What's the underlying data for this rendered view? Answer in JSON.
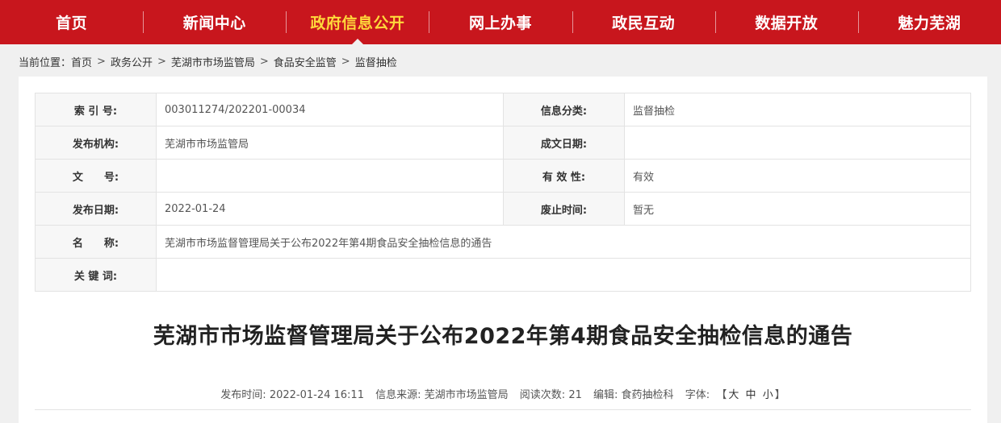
{
  "nav": {
    "items": [
      {
        "label": "首页"
      },
      {
        "label": "新闻中心"
      },
      {
        "label": "政府信息公开"
      },
      {
        "label": "网上办事"
      },
      {
        "label": "政民互动"
      },
      {
        "label": "数据开放"
      },
      {
        "label": "魅力芜湖"
      }
    ],
    "active_index": 2,
    "active_color": "#ffd93b",
    "bg_color": "#c8161d"
  },
  "breadcrumb": {
    "prefix": "当前位置：",
    "items": [
      "首页",
      "政务公开",
      "芜湖市市场监管局",
      "食品安全监管",
      "监督抽检"
    ],
    "separator": ">"
  },
  "info": {
    "index_no_label": "索 引 号:",
    "index_no": "003011274/202201-00034",
    "category_label": "信息分类:",
    "category": "监督抽检",
    "publisher_label": "发布机构:",
    "publisher": "芜湖市市场监管局",
    "created_label": "成文日期:",
    "created": "",
    "doc_no_label": "文　　号:",
    "doc_no": "",
    "validity_label": "有 效 性:",
    "validity": "有效",
    "pub_date_label": "发布日期:",
    "pub_date": "2022-01-24",
    "expire_label": "废止时间:",
    "expire": "暂无",
    "name_label": "名　　称:",
    "name": "芜湖市市场监督管理局关于公布2022年第4期食品安全抽检信息的通告",
    "keywords_label": "关 键 词:",
    "keywords": ""
  },
  "article": {
    "title": "芜湖市市场监督管理局关于公布2022年第4期食品安全抽检信息的通告"
  },
  "meta": {
    "time_label": "发布时间:",
    "time": "2022-01-24 16:11",
    "source_label": "信息来源:",
    "source": "芜湖市市场监管局",
    "views_label": "阅读次数:",
    "views": "21",
    "editor_label": "编辑:",
    "editor": "食药抽检科",
    "font_label": "字体:",
    "font_open": "【",
    "font_large": "大",
    "font_medium": "中",
    "font_small": "小",
    "font_close": "】"
  }
}
